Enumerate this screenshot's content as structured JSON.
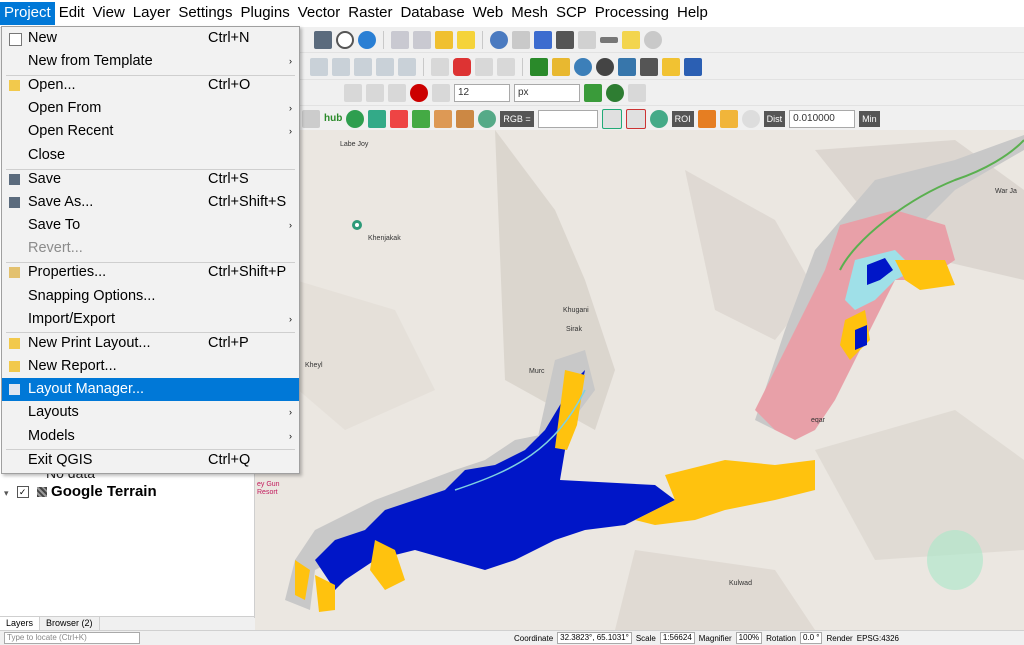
{
  "menubar": {
    "items": [
      "Project",
      "Edit",
      "View",
      "Layer",
      "Settings",
      "Plugins",
      "Vector",
      "Raster",
      "Database",
      "Web",
      "Mesh",
      "SCP",
      "Processing",
      "Help"
    ],
    "active": "Project"
  },
  "project_menu": {
    "items": [
      {
        "label": "New",
        "shortcut": "Ctrl+N"
      },
      {
        "label": "New from Template",
        "submenu": true
      },
      {
        "label": "Open...",
        "shortcut": "Ctrl+O"
      },
      {
        "label": "Open From",
        "submenu": true
      },
      {
        "label": "Open Recent",
        "submenu": true
      },
      {
        "label": "Close"
      },
      {
        "label": "Save",
        "shortcut": "Ctrl+S"
      },
      {
        "label": "Save As...",
        "shortcut": "Ctrl+Shift+S"
      },
      {
        "label": "Save To",
        "submenu": true
      },
      {
        "label": "Revert...",
        "disabled": true
      },
      {
        "label": "Properties...",
        "shortcut": "Ctrl+Shift+P"
      },
      {
        "label": "Snapping Options..."
      },
      {
        "label": "Import/Export",
        "submenu": true
      },
      {
        "label": "New Print Layout...",
        "shortcut": "Ctrl+P"
      },
      {
        "label": "New Report..."
      },
      {
        "label": "Layout Manager...",
        "highlighted": true
      },
      {
        "label": "Layouts",
        "submenu": true
      },
      {
        "label": "Models",
        "submenu": true
      },
      {
        "label": "Exit QGIS",
        "shortcut": "Ctrl+Q"
      }
    ],
    "submenu_arrow": "›"
  },
  "toolbar": {
    "font_size": "12",
    "font_unit": "px",
    "rgb_label": "RGB =",
    "roi_label": "ROI",
    "dist_label": "Dist",
    "dist_value": "0.010000",
    "min_label": "Min",
    "hub_label": "hub"
  },
  "layers": {
    "items": [
      {
        "name": "No data"
      },
      {
        "name": "Google Terrain",
        "checked": true
      }
    ],
    "checkmark": "✓",
    "expand": "▾"
  },
  "panel_tabs": [
    "Layers",
    "Browser (2)"
  ],
  "map": {
    "places": [
      "Labe Joy",
      "Khenjakak",
      "Khugani",
      "Sirak",
      "Murc",
      "Kheyl",
      "Kulwad",
      "War Ja",
      "eqar",
      "ey Gun",
      "Resort"
    ]
  },
  "statusbar": {
    "locator_placeholder": "Type to locate (Ctrl+K)",
    "coordinate_label": "Coordinate",
    "coordinate_value": "32.3823°, 65.1031°",
    "scale_label": "Scale",
    "scale_value": "1:56624",
    "magnifier_label": "Magnifier",
    "magnifier_value": "100%",
    "rotation_label": "Rotation",
    "rotation_value": "0.0 °",
    "render_label": "Render",
    "crs": "EPSG:4326"
  },
  "colors": {
    "accent": "#0078d7",
    "flood_blue": "#0016c8",
    "flood_yellow": "#ffc20e",
    "flood_pink": "#e8a0a8",
    "flood_gray": "#c8c8c8"
  }
}
